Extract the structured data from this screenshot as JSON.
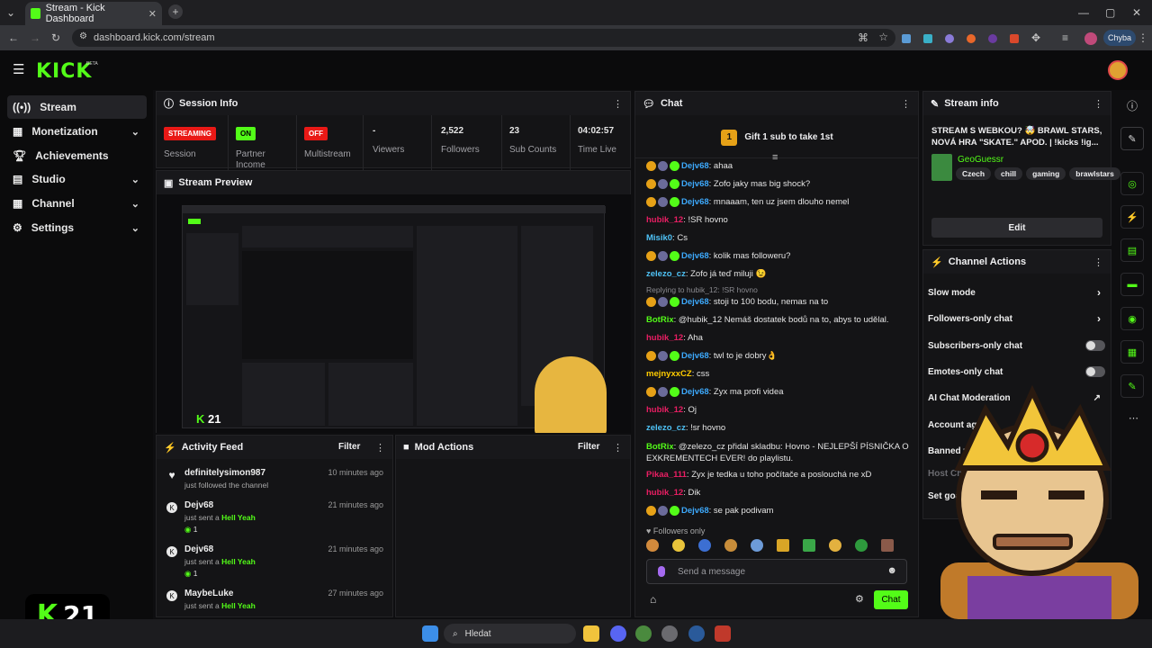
{
  "browser": {
    "tab_title": "Stream - Kick Dashboard",
    "new_tab": "+",
    "url": "dashboard.kick.com/stream",
    "profile_label": "Chyba"
  },
  "header": {
    "logo": "KICK",
    "logo_beta": "BETA"
  },
  "sidebar": {
    "items": [
      {
        "label": "Stream",
        "icon": "broadcast-icon",
        "active": true,
        "expandable": false
      },
      {
        "label": "Monetization",
        "icon": "dollar-icon",
        "active": false,
        "expandable": true
      },
      {
        "label": "Achievements",
        "icon": "trophy-icon",
        "active": false,
        "expandable": false
      },
      {
        "label": "Studio",
        "icon": "clapper-icon",
        "active": false,
        "expandable": true
      },
      {
        "label": "Channel",
        "icon": "grid-icon",
        "active": false,
        "expandable": true
      },
      {
        "label": "Settings",
        "icon": "gear-icon",
        "active": false,
        "expandable": true
      }
    ]
  },
  "session": {
    "title": "Session Info",
    "stats": [
      {
        "badge": "STREAMING",
        "badge_color": "#e91916",
        "label": "Session"
      },
      {
        "badge": "ON",
        "badge_color": "#53fc18",
        "label": "Partner Income"
      },
      {
        "badge": "OFF",
        "badge_color": "#e91916",
        "label": "Multistream"
      },
      {
        "value": "-",
        "label": "Viewers"
      },
      {
        "value": "2,522",
        "label": "Followers"
      },
      {
        "value": "23",
        "label": "Sub Counts"
      },
      {
        "value": "04:02:57",
        "label": "Time Live"
      }
    ]
  },
  "preview": {
    "title": "Stream Preview",
    "overlay_count": "21"
  },
  "activity": {
    "title": "Activity Feed",
    "filter": "Filter",
    "items": [
      {
        "name": "definitelysimon987",
        "time": "10 minutes ago",
        "text": "just followed the channel",
        "highlight": "",
        "count": ""
      },
      {
        "name": "Dejv68",
        "time": "21 minutes ago",
        "text": "just sent a",
        "highlight": "Hell Yeah",
        "count": "1"
      },
      {
        "name": "Dejv68",
        "time": "21 minutes ago",
        "text": "just sent a",
        "highlight": "Hell Yeah",
        "count": "1"
      },
      {
        "name": "MaybeLuke",
        "time": "27 minutes ago",
        "text": "just sent a",
        "highlight": "Hell Yeah",
        "count": ""
      }
    ]
  },
  "mod_actions": {
    "title": "Mod Actions",
    "filter": "Filter"
  },
  "chat": {
    "title": "Chat",
    "gift_banner": "Gift 1 sub to take 1st",
    "gift_rank": "1",
    "messages": [
      {
        "user": "Dejv68",
        "color": "#3da9fc",
        "text": "ahaa",
        "badges": true
      },
      {
        "user": "Dejv68",
        "color": "#3da9fc",
        "text": "Zofo jaky mas big shock?",
        "badges": true
      },
      {
        "user": "Dejv68",
        "color": "#3da9fc",
        "text": "mnaaam, ten uz jsem dlouho nemel",
        "badges": true
      },
      {
        "user": "hubik_12",
        "color": "#e91e63",
        "text": "!SR hovno",
        "badges": false
      },
      {
        "user": "Misik0",
        "color": "#4fc3f7",
        "text": "Cs",
        "badges": false
      },
      {
        "user": "Dejv68",
        "color": "#3da9fc",
        "text": "kolik mas followeru?",
        "badges": true
      },
      {
        "user": "zelezo_cz",
        "color": "#4fc3f7",
        "text": "Zofo já teď miluji 😉",
        "badges": false
      },
      {
        "user": "Dejv68",
        "color": "#3da9fc",
        "text": "stoji to 100 bodu, nemas na to",
        "badges": true,
        "reply": "Replying to hubik_12: !SR hovno"
      },
      {
        "user": "BotRix",
        "color": "#53fc18",
        "text": "@hubik_12 Nemáš dostatek bodů na to, abys to udělal.",
        "badges": false
      },
      {
        "user": "hubik_12",
        "color": "#e91e63",
        "text": "Aha",
        "badges": false
      },
      {
        "user": "Dejv68",
        "color": "#3da9fc",
        "text": "twl to je dobry👌",
        "badges": true
      },
      {
        "user": "mejnyxxCZ",
        "color": "#ffcc00",
        "text": "css",
        "badges": false
      },
      {
        "user": "Dejv68",
        "color": "#3da9fc",
        "text": "Zyx ma profi videa",
        "badges": true
      },
      {
        "user": "hubik_12",
        "color": "#e91e63",
        "text": "Oj",
        "badges": false
      },
      {
        "user": "zelezo_cz",
        "color": "#4fc3f7",
        "text": "!sr hovno",
        "badges": false
      },
      {
        "user": "BotRix",
        "color": "#53fc18",
        "text": "@zelezo_cz přidal skladbu: Hovno - NEJLEPŠÍ PÍSNIČKA O EXKREMENTECH EVER! do playlistu.",
        "badges": false
      },
      {
        "user": "Pikaa_111",
        "color": "#e91e63",
        "text": "Zyx je tedka u toho počítače a poslouchá ne xD",
        "badges": false
      },
      {
        "user": "hubik_12",
        "color": "#e91e63",
        "text": "Dik",
        "badges": false
      },
      {
        "user": "Dejv68",
        "color": "#3da9fc",
        "text": "se pak podivam",
        "badges": true
      }
    ],
    "followers_only": "Followers only",
    "input_placeholder": "Send a message",
    "send_label": "Chat"
  },
  "stream_info": {
    "title": "Stream info",
    "stream_title": "STREAM S WEBKOU? 🤯 BRAWL STARS, NOVÁ HRA \"SKATE.\" APOD. | !kicks !ig...",
    "category": "GeoGuessr",
    "tags": [
      "Czech",
      "chill",
      "gaming",
      "brawlstars"
    ],
    "edit_label": "Edit"
  },
  "channel_actions": {
    "title": "Channel Actions",
    "items": [
      {
        "label": "Slow mode",
        "control": "chevron"
      },
      {
        "label": "Followers-only chat",
        "control": "chevron"
      },
      {
        "label": "Subscribers-only chat",
        "control": "toggle"
      },
      {
        "label": "Emotes-only chat",
        "control": "toggle"
      },
      {
        "label": "AI Chat Moderation",
        "control": "external"
      },
      {
        "label": "Account age re",
        "control": "chevron"
      },
      {
        "label": "Banned wor",
        "control": "none"
      },
      {
        "label": "Host Channe",
        "control": "none"
      },
      {
        "label": "Set goals",
        "control": "none"
      }
    ]
  },
  "overlay_logo": {
    "text": "21"
  },
  "taskbar": {
    "search_placeholder": "Hledat"
  }
}
